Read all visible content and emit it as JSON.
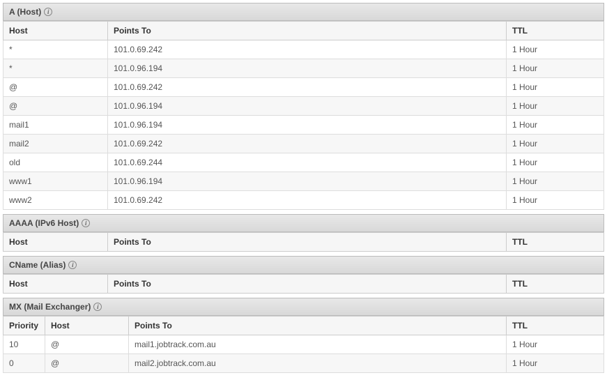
{
  "sections": {
    "a": {
      "title": "A (Host)",
      "columns": [
        "Host",
        "Points To",
        "TTL"
      ],
      "rows": [
        {
          "host": "*",
          "points_to": "101.0.69.242",
          "ttl": "1 Hour"
        },
        {
          "host": "*",
          "points_to": "101.0.96.194",
          "ttl": "1 Hour"
        },
        {
          "host": "@",
          "points_to": "101.0.69.242",
          "ttl": "1 Hour"
        },
        {
          "host": "@",
          "points_to": "101.0.96.194",
          "ttl": "1 Hour"
        },
        {
          "host": "mail1",
          "points_to": "101.0.96.194",
          "ttl": "1 Hour"
        },
        {
          "host": "mail2",
          "points_to": "101.0.69.242",
          "ttl": "1 Hour"
        },
        {
          "host": "old",
          "points_to": "101.0.69.244",
          "ttl": "1 Hour"
        },
        {
          "host": "www1",
          "points_to": "101.0.96.194",
          "ttl": "1 Hour"
        },
        {
          "host": "www2",
          "points_to": "101.0.69.242",
          "ttl": "1 Hour"
        }
      ]
    },
    "aaaa": {
      "title": "AAAA (IPv6 Host)",
      "columns": [
        "Host",
        "Points To",
        "TTL"
      ],
      "rows": []
    },
    "cname": {
      "title": "CName (Alias)",
      "columns": [
        "Host",
        "Points To",
        "TTL"
      ],
      "rows": []
    },
    "mx": {
      "title": "MX (Mail Exchanger)",
      "columns": [
        "Priority",
        "Host",
        "Points To",
        "TTL"
      ],
      "rows": [
        {
          "priority": "10",
          "host": "@",
          "points_to": "mail1.jobtrack.com.au",
          "ttl": "1 Hour"
        },
        {
          "priority": "0",
          "host": "@",
          "points_to": "mail2.jobtrack.com.au",
          "ttl": "1 Hour"
        }
      ]
    }
  }
}
